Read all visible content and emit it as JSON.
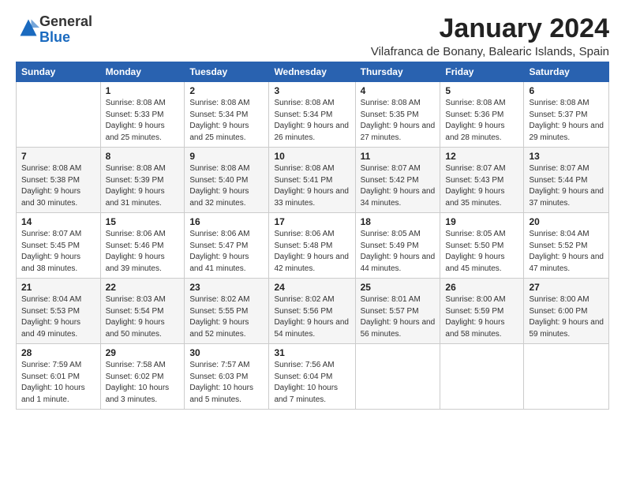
{
  "logo": {
    "general": "General",
    "blue": "Blue"
  },
  "header": {
    "month": "January 2024",
    "location": "Vilafranca de Bonany, Balearic Islands, Spain"
  },
  "weekdays": [
    "Sunday",
    "Monday",
    "Tuesday",
    "Wednesday",
    "Thursday",
    "Friday",
    "Saturday"
  ],
  "weeks": [
    [
      {
        "day": "",
        "sunrise": "",
        "sunset": "",
        "daylight": ""
      },
      {
        "day": "1",
        "sunrise": "Sunrise: 8:08 AM",
        "sunset": "Sunset: 5:33 PM",
        "daylight": "Daylight: 9 hours and 25 minutes."
      },
      {
        "day": "2",
        "sunrise": "Sunrise: 8:08 AM",
        "sunset": "Sunset: 5:34 PM",
        "daylight": "Daylight: 9 hours and 25 minutes."
      },
      {
        "day": "3",
        "sunrise": "Sunrise: 8:08 AM",
        "sunset": "Sunset: 5:34 PM",
        "daylight": "Daylight: 9 hours and 26 minutes."
      },
      {
        "day": "4",
        "sunrise": "Sunrise: 8:08 AM",
        "sunset": "Sunset: 5:35 PM",
        "daylight": "Daylight: 9 hours and 27 minutes."
      },
      {
        "day": "5",
        "sunrise": "Sunrise: 8:08 AM",
        "sunset": "Sunset: 5:36 PM",
        "daylight": "Daylight: 9 hours and 28 minutes."
      },
      {
        "day": "6",
        "sunrise": "Sunrise: 8:08 AM",
        "sunset": "Sunset: 5:37 PM",
        "daylight": "Daylight: 9 hours and 29 minutes."
      }
    ],
    [
      {
        "day": "7",
        "sunrise": "Sunrise: 8:08 AM",
        "sunset": "Sunset: 5:38 PM",
        "daylight": "Daylight: 9 hours and 30 minutes."
      },
      {
        "day": "8",
        "sunrise": "Sunrise: 8:08 AM",
        "sunset": "Sunset: 5:39 PM",
        "daylight": "Daylight: 9 hours and 31 minutes."
      },
      {
        "day": "9",
        "sunrise": "Sunrise: 8:08 AM",
        "sunset": "Sunset: 5:40 PM",
        "daylight": "Daylight: 9 hours and 32 minutes."
      },
      {
        "day": "10",
        "sunrise": "Sunrise: 8:08 AM",
        "sunset": "Sunset: 5:41 PM",
        "daylight": "Daylight: 9 hours and 33 minutes."
      },
      {
        "day": "11",
        "sunrise": "Sunrise: 8:07 AM",
        "sunset": "Sunset: 5:42 PM",
        "daylight": "Daylight: 9 hours and 34 minutes."
      },
      {
        "day": "12",
        "sunrise": "Sunrise: 8:07 AM",
        "sunset": "Sunset: 5:43 PM",
        "daylight": "Daylight: 9 hours and 35 minutes."
      },
      {
        "day": "13",
        "sunrise": "Sunrise: 8:07 AM",
        "sunset": "Sunset: 5:44 PM",
        "daylight": "Daylight: 9 hours and 37 minutes."
      }
    ],
    [
      {
        "day": "14",
        "sunrise": "Sunrise: 8:07 AM",
        "sunset": "Sunset: 5:45 PM",
        "daylight": "Daylight: 9 hours and 38 minutes."
      },
      {
        "day": "15",
        "sunrise": "Sunrise: 8:06 AM",
        "sunset": "Sunset: 5:46 PM",
        "daylight": "Daylight: 9 hours and 39 minutes."
      },
      {
        "day": "16",
        "sunrise": "Sunrise: 8:06 AM",
        "sunset": "Sunset: 5:47 PM",
        "daylight": "Daylight: 9 hours and 41 minutes."
      },
      {
        "day": "17",
        "sunrise": "Sunrise: 8:06 AM",
        "sunset": "Sunset: 5:48 PM",
        "daylight": "Daylight: 9 hours and 42 minutes."
      },
      {
        "day": "18",
        "sunrise": "Sunrise: 8:05 AM",
        "sunset": "Sunset: 5:49 PM",
        "daylight": "Daylight: 9 hours and 44 minutes."
      },
      {
        "day": "19",
        "sunrise": "Sunrise: 8:05 AM",
        "sunset": "Sunset: 5:50 PM",
        "daylight": "Daylight: 9 hours and 45 minutes."
      },
      {
        "day": "20",
        "sunrise": "Sunrise: 8:04 AM",
        "sunset": "Sunset: 5:52 PM",
        "daylight": "Daylight: 9 hours and 47 minutes."
      }
    ],
    [
      {
        "day": "21",
        "sunrise": "Sunrise: 8:04 AM",
        "sunset": "Sunset: 5:53 PM",
        "daylight": "Daylight: 9 hours and 49 minutes."
      },
      {
        "day": "22",
        "sunrise": "Sunrise: 8:03 AM",
        "sunset": "Sunset: 5:54 PM",
        "daylight": "Daylight: 9 hours and 50 minutes."
      },
      {
        "day": "23",
        "sunrise": "Sunrise: 8:02 AM",
        "sunset": "Sunset: 5:55 PM",
        "daylight": "Daylight: 9 hours and 52 minutes."
      },
      {
        "day": "24",
        "sunrise": "Sunrise: 8:02 AM",
        "sunset": "Sunset: 5:56 PM",
        "daylight": "Daylight: 9 hours and 54 minutes."
      },
      {
        "day": "25",
        "sunrise": "Sunrise: 8:01 AM",
        "sunset": "Sunset: 5:57 PM",
        "daylight": "Daylight: 9 hours and 56 minutes."
      },
      {
        "day": "26",
        "sunrise": "Sunrise: 8:00 AM",
        "sunset": "Sunset: 5:59 PM",
        "daylight": "Daylight: 9 hours and 58 minutes."
      },
      {
        "day": "27",
        "sunrise": "Sunrise: 8:00 AM",
        "sunset": "Sunset: 6:00 PM",
        "daylight": "Daylight: 9 hours and 59 minutes."
      }
    ],
    [
      {
        "day": "28",
        "sunrise": "Sunrise: 7:59 AM",
        "sunset": "Sunset: 6:01 PM",
        "daylight": "Daylight: 10 hours and 1 minute."
      },
      {
        "day": "29",
        "sunrise": "Sunrise: 7:58 AM",
        "sunset": "Sunset: 6:02 PM",
        "daylight": "Daylight: 10 hours and 3 minutes."
      },
      {
        "day": "30",
        "sunrise": "Sunrise: 7:57 AM",
        "sunset": "Sunset: 6:03 PM",
        "daylight": "Daylight: 10 hours and 5 minutes."
      },
      {
        "day": "31",
        "sunrise": "Sunrise: 7:56 AM",
        "sunset": "Sunset: 6:04 PM",
        "daylight": "Daylight: 10 hours and 7 minutes."
      },
      {
        "day": "",
        "sunrise": "",
        "sunset": "",
        "daylight": ""
      },
      {
        "day": "",
        "sunrise": "",
        "sunset": "",
        "daylight": ""
      },
      {
        "day": "",
        "sunrise": "",
        "sunset": "",
        "daylight": ""
      }
    ]
  ]
}
